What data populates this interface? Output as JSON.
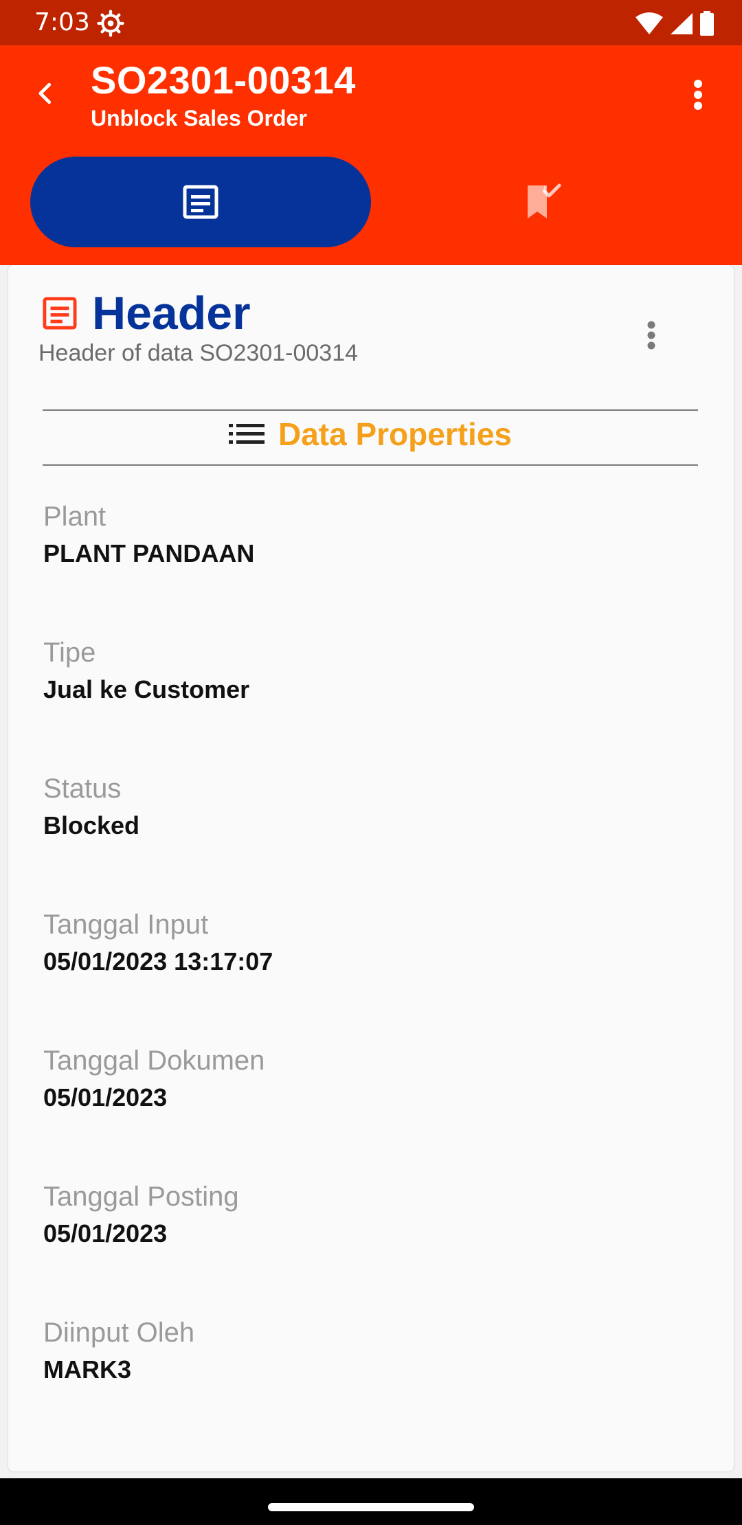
{
  "status_bar": {
    "time": "7:03",
    "icons": [
      "settings-gear-icon",
      "wifi-icon",
      "signal-icon",
      "battery-icon"
    ]
  },
  "app_bar": {
    "title": "SO2301-00314",
    "subtitle": "Unblock Sales Order",
    "back_icon": "chevron-left-icon",
    "menu_icon": "more-vertical-icon",
    "tabs": [
      {
        "icon": "document-icon",
        "active": true
      },
      {
        "icon": "bookmark-check-icon",
        "active": false
      }
    ]
  },
  "card": {
    "icon": "document-icon",
    "title": "Header",
    "subtitle": "Header of data SO2301-00314",
    "section_title": "Data Properties",
    "section_icon": "list-icon",
    "properties": [
      {
        "label": "Plant",
        "value": "PLANT PANDAAN"
      },
      {
        "label": "Tipe",
        "value": "Jual ke Customer"
      },
      {
        "label": "Status",
        "value": "Blocked"
      },
      {
        "label": "Tanggal Input",
        "value": "05/01/2023 13:17:07"
      },
      {
        "label": "Tanggal Dokumen",
        "value": "05/01/2023"
      },
      {
        "label": "Tanggal Posting",
        "value": "05/01/2023"
      },
      {
        "label": "Diinput Oleh",
        "value": "MARK3"
      }
    ]
  },
  "colors": {
    "status_bar": "#bf2400",
    "app_bar": "#ff3000",
    "active_tab": "#06339a",
    "title_blue": "#06339a",
    "section_orange": "#f5a01a",
    "label_gray": "#9a9a9a"
  }
}
